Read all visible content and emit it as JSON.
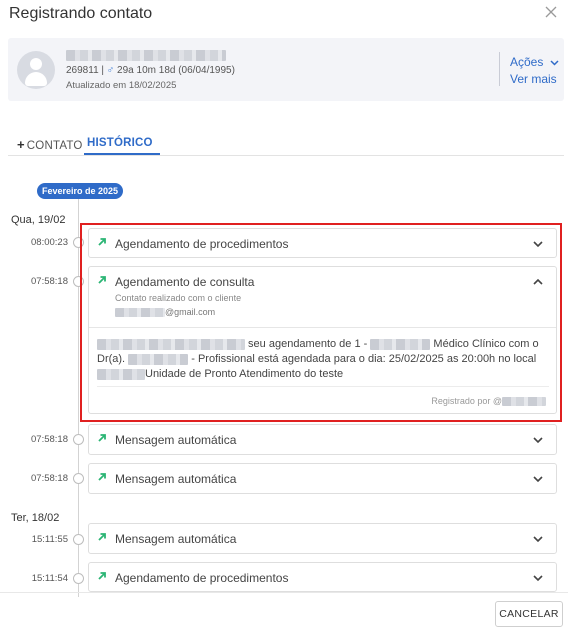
{
  "modal": {
    "title": "Registrando contato"
  },
  "patient": {
    "meta_prefix": "269811 | ",
    "meta_gender": "♂",
    "meta_age": " 29a 10m 18d (06/04/1995)",
    "updated": "Atualizado em 18/02/2025",
    "actions_label": "Ações",
    "see_more_label": "Ver mais"
  },
  "tabs": {
    "contato": "CONTATO",
    "historico": "HISTÓRICO"
  },
  "timeline": {
    "month_badge": "Fevereiro de 2025",
    "days": [
      "Qua, 19/02",
      "Ter, 18/02"
    ],
    "entries": [
      {
        "time": "08:00:23",
        "title": "Agendamento de procedimentos"
      },
      {
        "time": "07:58:18",
        "title": "Agendamento de consulta",
        "subtitle": "Contato realizado com o cliente",
        "email_suffix": "@gmail.com",
        "msg_part1": " seu agendamento de 1 - ",
        "msg_part2": " Médico Clínico com o Dr(a). ",
        "msg_part3": " - Profissional está agendada para o dia: 25/02/2025 as 20:00h no local ",
        "msg_part4": "Unidade de Pronto Atendimento do teste",
        "registered_by": "Registrado por @"
      },
      {
        "time": "07:58:18",
        "title": "Mensagem automática"
      },
      {
        "time": "07:58:18",
        "title": "Mensagem automática"
      },
      {
        "time": "15:11:55",
        "title": "Mensagem automática"
      },
      {
        "time": "15:11:54",
        "title": "Agendamento de procedimentos"
      }
    ]
  },
  "footer": {
    "cancel_label": "CANCELAR"
  },
  "colors": {
    "accent": "#2f6bc8",
    "arrow": "#2bb574",
    "highlight": "#e02020"
  }
}
